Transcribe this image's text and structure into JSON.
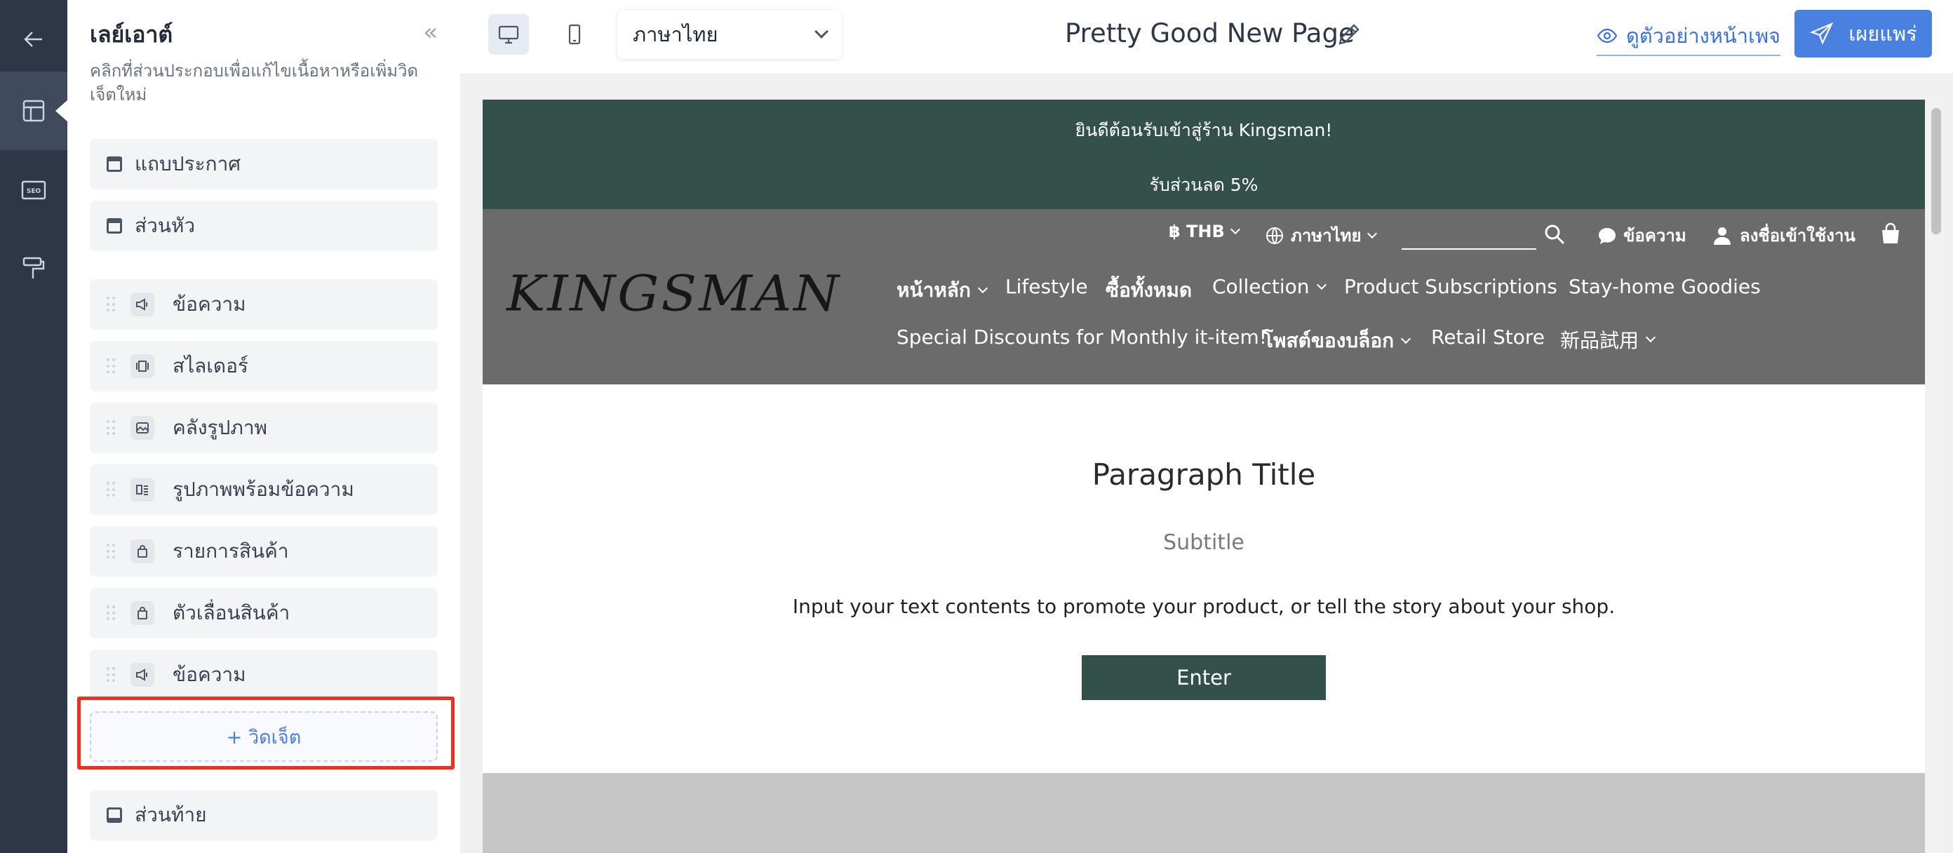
{
  "panel": {
    "title": "เลย์เอาต์",
    "description": "คลิกที่ส่วนประกอบเพื่อแก้ไขเนื้อหาหรือเพิ่มวิดเจ็ตใหม่",
    "announcement_bar": "แถบประกาศ",
    "header": "ส่วนหัว",
    "widgets": [
      {
        "label": "ข้อความ",
        "icon": "megaphone-icon"
      },
      {
        "label": "สไลเดอร์",
        "icon": "slider-icon"
      },
      {
        "label": "คลังรูปภาพ",
        "icon": "image-icon"
      },
      {
        "label": "รูปภาพพร้อมข้อความ",
        "icon": "image-text-icon"
      },
      {
        "label": "รายการสินค้า",
        "icon": "shopping-bag-icon"
      },
      {
        "label": "ตัวเลื่อนสินค้า",
        "icon": "shopping-bag-icon"
      },
      {
        "label": "ข้อความ",
        "icon": "megaphone-icon"
      }
    ],
    "add_widget": "+ วิดเจ็ต",
    "footer": "ส่วนท้าย"
  },
  "topbar": {
    "language": "ภาษาไทย",
    "page_title": "Pretty Good New Page",
    "preview": "ดูตัวอย่างหน้าเพจ",
    "publish": "เผยแพร่"
  },
  "preview": {
    "announcement": {
      "line1": "ยินดีต้อนรับเข้าสู่ร้าน Kingsman!",
      "line2": "รับส่วนลด 5%"
    },
    "header": {
      "logo": "KINGSMAN",
      "currency": "฿ THB",
      "language": "ภาษาไทย",
      "messages": "ข้อความ",
      "login": "ลงชื่อเข้าใช้งาน",
      "nav_row1": [
        "หน้าหลัก",
        "Lifestyle",
        "ซื้อทั้งหมด",
        "Collection",
        "Product Subscriptions",
        "Stay-home Goodies"
      ],
      "nav_row2": [
        "Special Discounts for Monthly it-item!",
        "โพสต์ของบล็อก",
        "Retail Store",
        "新品試用"
      ]
    },
    "content": {
      "title": "Paragraph Title",
      "subtitle": "Subtitle",
      "body": "Input your text contents to promote your product, or tell the story about your shop.",
      "button": "Enter"
    }
  },
  "colors": {
    "accent": "#4a80e0",
    "rail": "#2d3748",
    "announcement_bg": "#34504a",
    "header_bg": "#6b6b6b",
    "highlight": "#ef2f1f"
  }
}
